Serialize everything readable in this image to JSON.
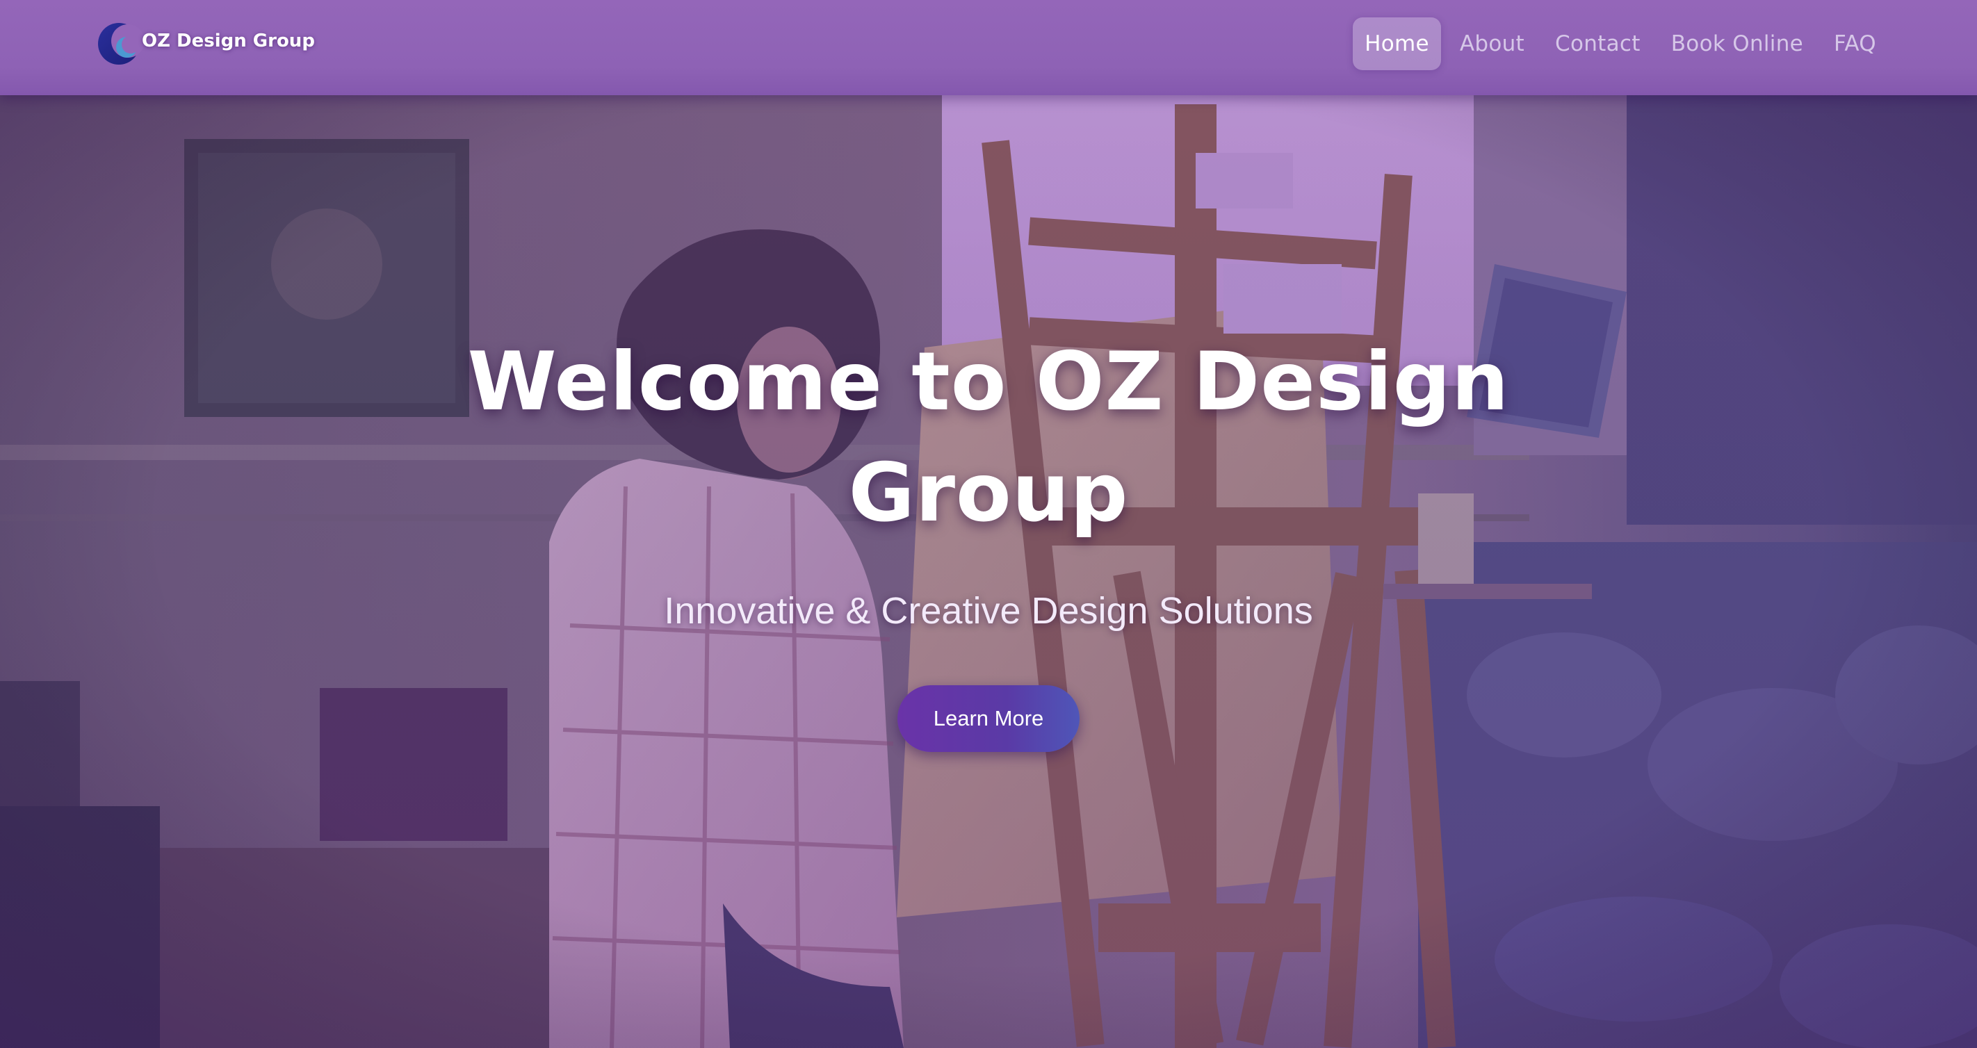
{
  "colors": {
    "navbar": "#9466b9",
    "nav_active_bg": "rgba(255,255,255,0.25)",
    "cta_start": "#6a33a8",
    "cta_end": "#4f56b8",
    "text": "#ffffff"
  },
  "header": {
    "logo_icon": "crescent-moon-logo-icon",
    "logo_text": "OZ Design Group",
    "nav": [
      {
        "label": "Home",
        "active": true
      },
      {
        "label": "About",
        "active": false
      },
      {
        "label": "Contact",
        "active": false
      },
      {
        "label": "Book Online",
        "active": false
      },
      {
        "label": "FAQ",
        "active": false
      }
    ]
  },
  "hero": {
    "background": "artist-painting-at-easel-photo",
    "headline": "Welcome to OZ Design Group",
    "subtitle": "Innovative & Creative Design Solutions",
    "cta_label": "Learn More"
  }
}
